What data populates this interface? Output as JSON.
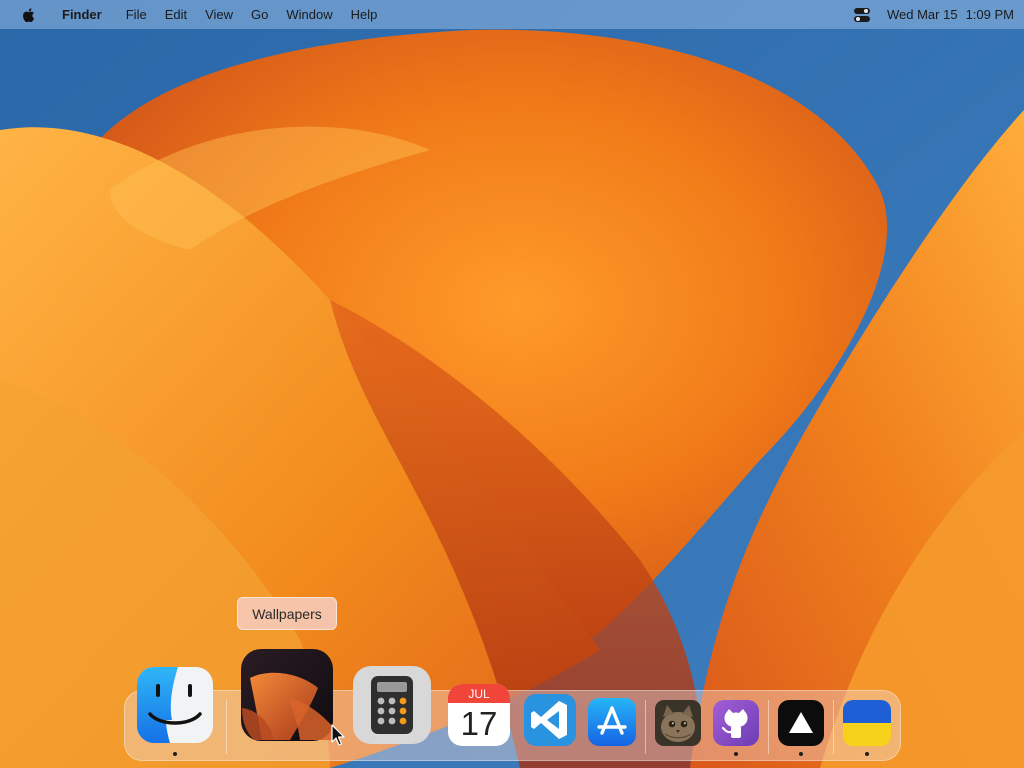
{
  "menubar": {
    "apple_icon": "apple-logo-icon",
    "app_name": "Finder",
    "items": [
      "File",
      "Edit",
      "View",
      "Go",
      "Window",
      "Help"
    ],
    "control_center_icon": "control-center-icon",
    "date": "Wed Mar 15",
    "time": "1:09 PM"
  },
  "tooltip": {
    "label": "Wallpapers"
  },
  "dock": {
    "items": [
      {
        "name": "finder",
        "icon": "finder-icon",
        "running": true
      },
      {
        "name": "wallpapers",
        "icon": "wallpapers-icon",
        "running": false
      },
      {
        "name": "calculator",
        "icon": "calculator-icon",
        "running": false
      },
      {
        "name": "calendar",
        "icon": "calendar-icon",
        "running": false,
        "month": "JUL",
        "day": "17"
      },
      {
        "name": "vscode",
        "icon": "vscode-icon",
        "running": false
      },
      {
        "name": "app-store",
        "icon": "app-store-icon",
        "running": false
      },
      {
        "name": "cat-app",
        "icon": "cat-photo-icon",
        "running": false
      },
      {
        "name": "github",
        "icon": "github-icon",
        "running": true
      },
      {
        "name": "vercel",
        "icon": "triangle-icon",
        "running": true
      },
      {
        "name": "ukraine-flag",
        "icon": "ukraine-flag-icon",
        "running": true
      }
    ]
  },
  "colors": {
    "wallpaper_blue": "#2f6cab",
    "wallpaper_orange": "#f28a1c",
    "wallpaper_deep": "#c8410f",
    "accent_vscode": "#1f8ad6",
    "accent_appstore": "#1a7cf0"
  }
}
